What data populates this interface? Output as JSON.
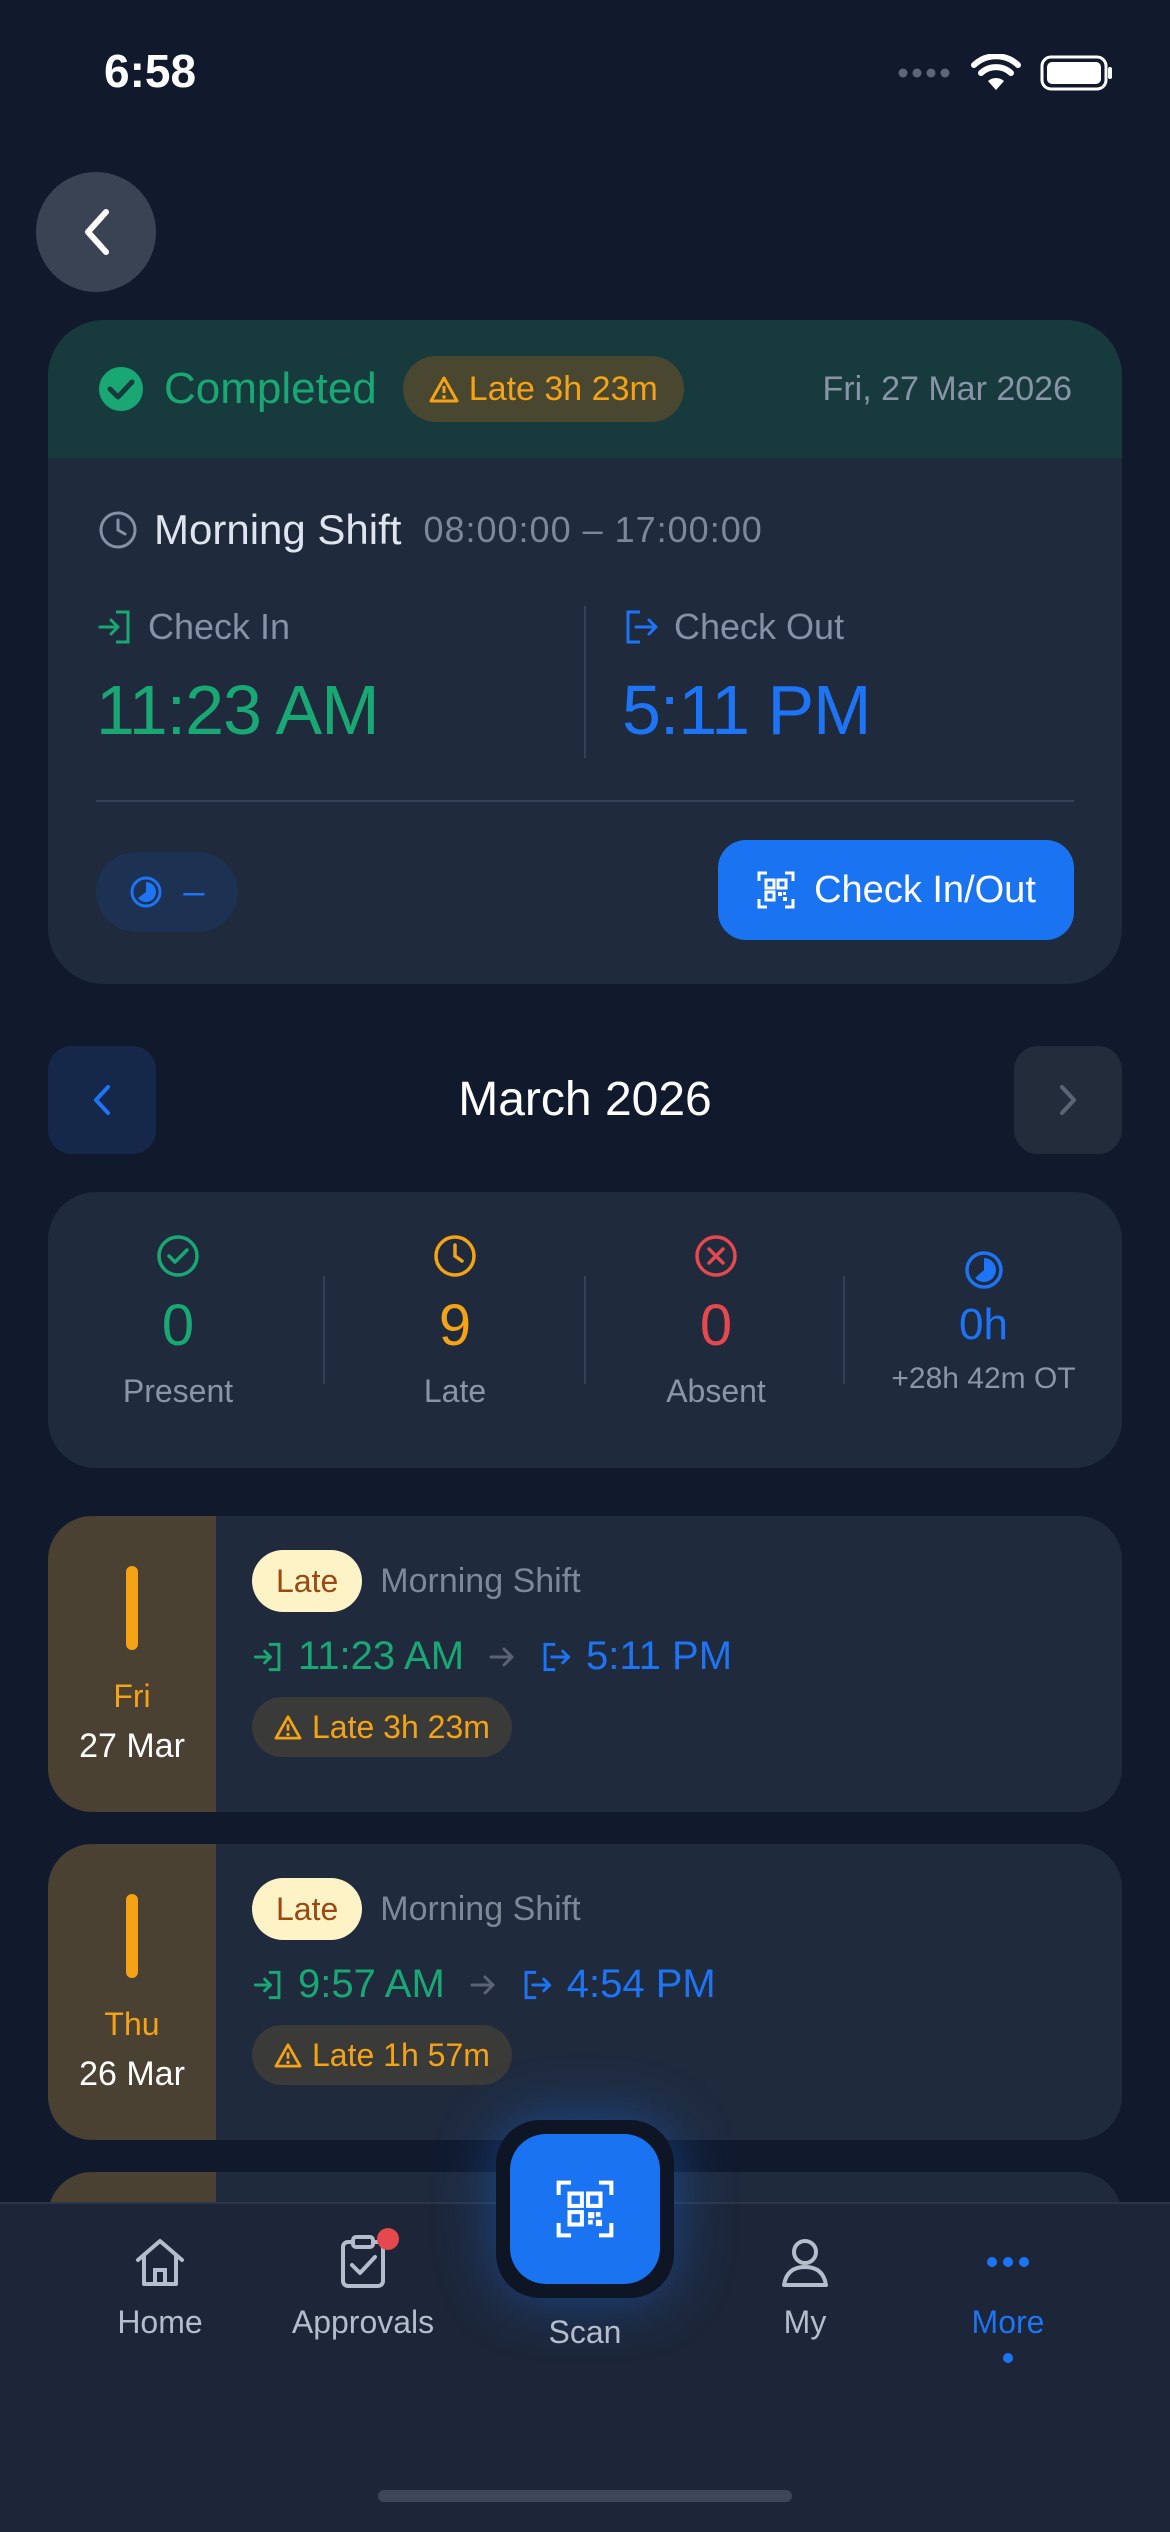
{
  "status_bar": {
    "time": "6:58"
  },
  "today": {
    "status": "Completed",
    "late_badge": "Late 3h 23m",
    "date": "Fri, 27 Mar 2026",
    "shift_name": "Morning Shift",
    "shift_hours": "08:00:00 – 17:00:00",
    "check_in_label": "Check In",
    "check_in_time": "11:23 AM",
    "check_out_label": "Check Out",
    "check_out_time": "5:11 PM",
    "overtime_value": "–",
    "check_button": "Check In/Out"
  },
  "month": {
    "title": "March 2026"
  },
  "summary": {
    "present": {
      "value": "0",
      "label": "Present"
    },
    "late": {
      "value": "9",
      "label": "Late"
    },
    "absent": {
      "value": "0",
      "label": "Absent"
    },
    "hours": {
      "value": "0h",
      "label": "+28h 42m OT"
    }
  },
  "records": [
    {
      "weekday": "Fri",
      "date": "27 Mar",
      "badge": "Late",
      "shift": "Morning Shift",
      "in": "11:23 AM",
      "out": "5:11 PM",
      "late": "Late 3h 23m"
    },
    {
      "weekday": "Thu",
      "date": "26 Mar",
      "badge": "Late",
      "shift": "Morning Shift",
      "in": "9:57 AM",
      "out": "4:54 PM",
      "late": "Late 1h 57m"
    }
  ],
  "tabs": {
    "home": "Home",
    "approvals": "Approvals",
    "scan": "Scan",
    "my": "My",
    "more": "More"
  },
  "colors": {
    "background": "#111a2d",
    "card": "#1f2a3d",
    "green": "#19a874",
    "blue": "#1a73f0",
    "amber": "#f4a316",
    "red": "#e5484d"
  }
}
